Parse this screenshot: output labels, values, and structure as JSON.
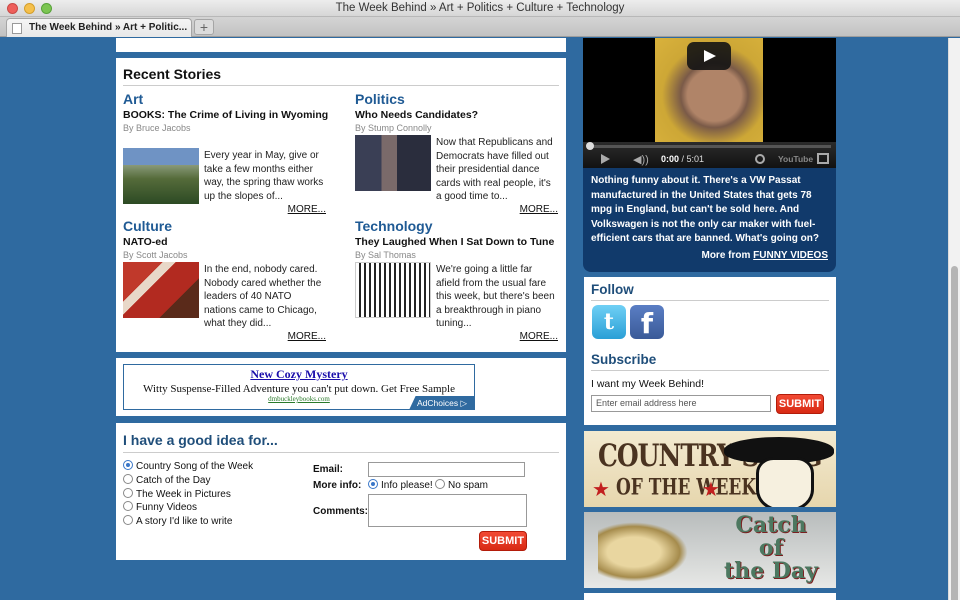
{
  "browser": {
    "window_title": "The Week Behind » Art + Politics + Culture + Technology",
    "tab_title": "The Week Behind » Art + Politic...",
    "new_tab": "+"
  },
  "recent": {
    "heading": "Recent Stories",
    "more_label": "MORE...",
    "stories": [
      {
        "category": "Art",
        "title": "BOOKS: The Crime of Living in Wyoming",
        "byline": "By Bruce Jacobs",
        "blurb": "Every year in May, give or take a few months either way, the spring thaw works up the slopes of..."
      },
      {
        "category": "Politics",
        "title": "Who Needs Candidates?",
        "byline": "By Stump Connolly",
        "blurb": "Now that Republicans and Democrats have filled out their presidential dance cards with real people, it's a good time to..."
      },
      {
        "category": "Culture",
        "title": "NATO-ed",
        "byline": "By Scott Jacobs",
        "blurb": "In the end, nobody cared. Nobody cared whether the leaders of 40 NATO nations came to Chicago, what they did..."
      },
      {
        "category": "Technology",
        "title": "They Laughed When I Sat Down to Tune",
        "byline": "By Sal Thomas",
        "blurb": "We're going a little far afield from the usual fare this week, but there's been a breakthrough in piano tuning..."
      }
    ]
  },
  "ad": {
    "title": "New Cozy Mystery",
    "text": "Witty Suspense-Filled Adventure you can't put down. Get Free Sample",
    "url": "dmbuckleybooks.com",
    "choices": "AdChoices ▷"
  },
  "idea": {
    "heading": "I have a good idea for...",
    "options": [
      "Country Song of the Week",
      "Catch of the Day",
      "The Week in Pictures",
      "Funny Videos",
      "A story I'd like to write"
    ],
    "selected_index": 0,
    "email_label": "Email:",
    "moreinfo_label": "More info:",
    "info_please": "Info please!",
    "no_spam": "No spam",
    "comments_label": "Comments:",
    "submit": "SUBMIT"
  },
  "video": {
    "time": "0:00",
    "duration": "/ 5:01",
    "youtube": "YouTube",
    "description": "Nothing funny about it. There's a VW Passat manufactured in the United States that gets 78 mpg in England, but can't be sold here. And Volkswagen is not the only car maker with fuel-efficient cars that are banned. What's going on?",
    "more_prefix": "More from ",
    "more_link": "FUNNY VIDEOS"
  },
  "follow": {
    "heading": "Follow",
    "subscribe_heading": "Subscribe",
    "subscribe_text": "I want my Week Behind!",
    "email_placeholder": "Enter email address here",
    "submit": "SUBMIT",
    "twitter_glyph": "t",
    "facebook_glyph": "f"
  },
  "banners": {
    "country_line1": "COUNTRY SONG",
    "country_line2": "OF THE WEEK",
    "catch_line1": "Catch",
    "catch_line2": "of",
    "catch_line3": "the Day"
  },
  "colors": {
    "page_bg": "#2f6aa0",
    "link_blue": "#1f5a94",
    "submit_red": "#e23a22",
    "video_panel": "#113a6b"
  }
}
